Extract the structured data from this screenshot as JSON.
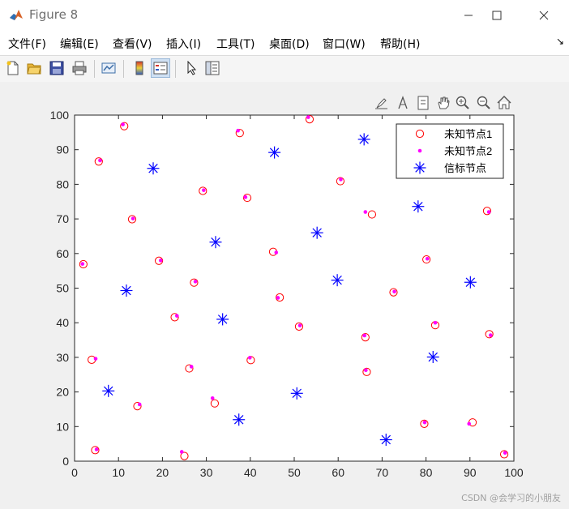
{
  "window": {
    "title": "Figure 8"
  },
  "menu": [
    "文件(F)",
    "编辑(E)",
    "查看(V)",
    "插入(I)",
    "工具(T)",
    "桌面(D)",
    "窗口(W)",
    "帮助(H)"
  ],
  "toolbar": [
    "new-file-icon",
    "open-folder-icon",
    "save-icon",
    "print-icon",
    "link-plot-icon",
    "colorbar-icon",
    "legend-icon",
    "pointer-icon",
    "property-inspector-icon"
  ],
  "axes_toolbar": [
    "brush-icon",
    "data-cursor-icon",
    "pan-icon",
    "zoom-in-icon",
    "zoom-out-icon",
    "home-icon"
  ],
  "watermark": "CSDN @会学习的小朋友",
  "chart_data": {
    "type": "scatter",
    "xlim": [
      0,
      100
    ],
    "ylim": [
      0,
      100
    ],
    "xticks": [
      0,
      10,
      20,
      30,
      40,
      50,
      60,
      70,
      80,
      90,
      100
    ],
    "yticks": [
      0,
      10,
      20,
      30,
      40,
      50,
      60,
      70,
      80,
      90,
      100
    ],
    "grid": false,
    "legend_position": "top-right",
    "series": [
      {
        "name": "未知节点1",
        "marker": "circle-open",
        "color": "#ff0000",
        "points": [
          [
            11.3,
            96.8
          ],
          [
            53.5,
            98.8
          ],
          [
            37.6,
            94.8
          ],
          [
            5.5,
            86.6
          ],
          [
            60.5,
            80.9
          ],
          [
            29.2,
            78.1
          ],
          [
            39.3,
            76.1
          ],
          [
            67.7,
            71.3
          ],
          [
            13.1,
            69.9
          ],
          [
            93.9,
            72.3
          ],
          [
            2.0,
            56.9
          ],
          [
            45.2,
            60.5
          ],
          [
            19.2,
            57.9
          ],
          [
            80.1,
            58.3
          ],
          [
            27.2,
            51.6
          ],
          [
            72.6,
            48.8
          ],
          [
            46.7,
            47.3
          ],
          [
            22.8,
            41.6
          ],
          [
            51.1,
            38.9
          ],
          [
            82.1,
            39.3
          ],
          [
            66.2,
            35.8
          ],
          [
            94.4,
            36.7
          ],
          [
            3.9,
            29.3
          ],
          [
            40.1,
            29.2
          ],
          [
            26.1,
            26.8
          ],
          [
            66.5,
            25.8
          ],
          [
            14.3,
            15.9
          ],
          [
            31.9,
            16.7
          ],
          [
            79.6,
            10.8
          ],
          [
            90.6,
            11.2
          ],
          [
            4.7,
            3.2
          ],
          [
            25.0,
            1.5
          ],
          [
            97.8,
            2.0
          ]
        ]
      },
      {
        "name": "未知节点2",
        "marker": "dot",
        "color": "#ff00ff",
        "points": [
          [
            11.0,
            97.3
          ],
          [
            53.2,
            99.4
          ],
          [
            37.2,
            95.5
          ],
          [
            5.8,
            86.9
          ],
          [
            60.6,
            81.4
          ],
          [
            29.4,
            78.3
          ],
          [
            38.9,
            76.3
          ],
          [
            66.2,
            72.0
          ],
          [
            13.3,
            70.1
          ],
          [
            94.3,
            72.0
          ],
          [
            1.8,
            57.0
          ],
          [
            45.9,
            60.3
          ],
          [
            19.6,
            58.0
          ],
          [
            80.3,
            58.5
          ],
          [
            27.5,
            51.9
          ],
          [
            72.8,
            49.0
          ],
          [
            46.3,
            47.2
          ],
          [
            23.3,
            42.0
          ],
          [
            51.3,
            39.2
          ],
          [
            82.1,
            40.0
          ],
          [
            66.0,
            36.3
          ],
          [
            94.7,
            36.4
          ],
          [
            4.8,
            29.6
          ],
          [
            39.9,
            29.9
          ],
          [
            26.6,
            27.3
          ],
          [
            66.3,
            26.3
          ],
          [
            14.8,
            16.4
          ],
          [
            31.4,
            18.2
          ],
          [
            79.7,
            11.2
          ],
          [
            89.8,
            10.8
          ],
          [
            5.0,
            3.4
          ],
          [
            24.4,
            2.7
          ],
          [
            98.0,
            2.4
          ]
        ]
      },
      {
        "name": "信标节点",
        "marker": "asterisk",
        "color": "#0000ff",
        "points": [
          [
            17.9,
            84.6
          ],
          [
            45.5,
            89.2
          ],
          [
            65.9,
            93.0
          ],
          [
            78.2,
            73.6
          ],
          [
            32.1,
            63.3
          ],
          [
            55.2,
            66.0
          ],
          [
            11.8,
            49.3
          ],
          [
            59.8,
            52.3
          ],
          [
            90.1,
            51.7
          ],
          [
            33.7,
            41.0
          ],
          [
            81.6,
            30.1
          ],
          [
            7.7,
            20.3
          ],
          [
            50.6,
            19.6
          ],
          [
            37.4,
            12.0
          ],
          [
            70.9,
            6.2
          ]
        ]
      }
    ]
  }
}
